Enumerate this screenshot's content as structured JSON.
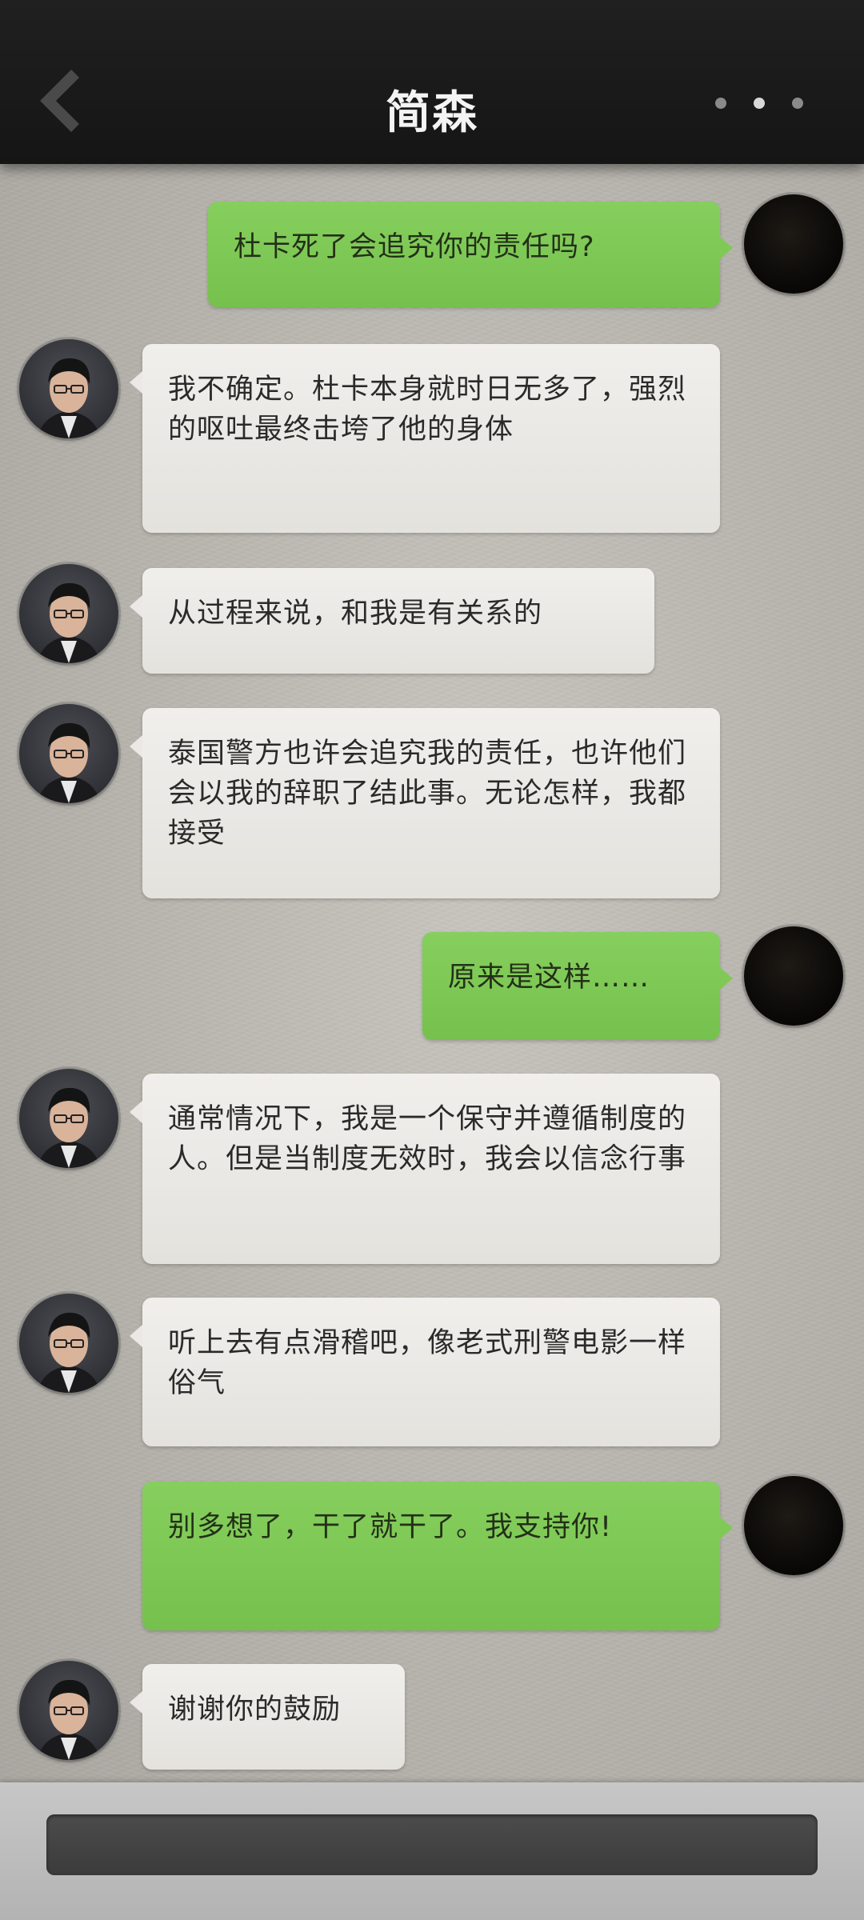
{
  "header": {
    "title": "简森",
    "back_icon": "chevron-left-icon",
    "more_icon": "more-dots-icon"
  },
  "messages": [
    {
      "sender": "me",
      "text": "杜卡死了会追究你的责任吗?"
    },
    {
      "sender": "npc",
      "text": "我不确定。杜卡本身就时日无多了，强烈的呕吐最终击垮了他的身体"
    },
    {
      "sender": "npc",
      "text": "从过程来说，和我是有关系的"
    },
    {
      "sender": "npc",
      "text": "泰国警方也许会追究我的责任，也许他们会以我的辞职了结此事。无论怎样，我都接受"
    },
    {
      "sender": "me",
      "text": "原来是这样……"
    },
    {
      "sender": "npc",
      "text": "通常情况下，我是一个保守并遵循制度的人。但是当制度无效时，我会以信念行事"
    },
    {
      "sender": "npc",
      "text": "听上去有点滑稽吧，像老式刑警电影一样俗气"
    },
    {
      "sender": "me",
      "text": "别多想了，干了就干了。我支持你!"
    },
    {
      "sender": "npc",
      "text": "谢谢你的鼓励"
    }
  ],
  "colors": {
    "header": "#1b1b1b",
    "me_bubble": "#7ec755",
    "npc_bubble": "#ebe9e5",
    "background": "#bcb9b3"
  }
}
